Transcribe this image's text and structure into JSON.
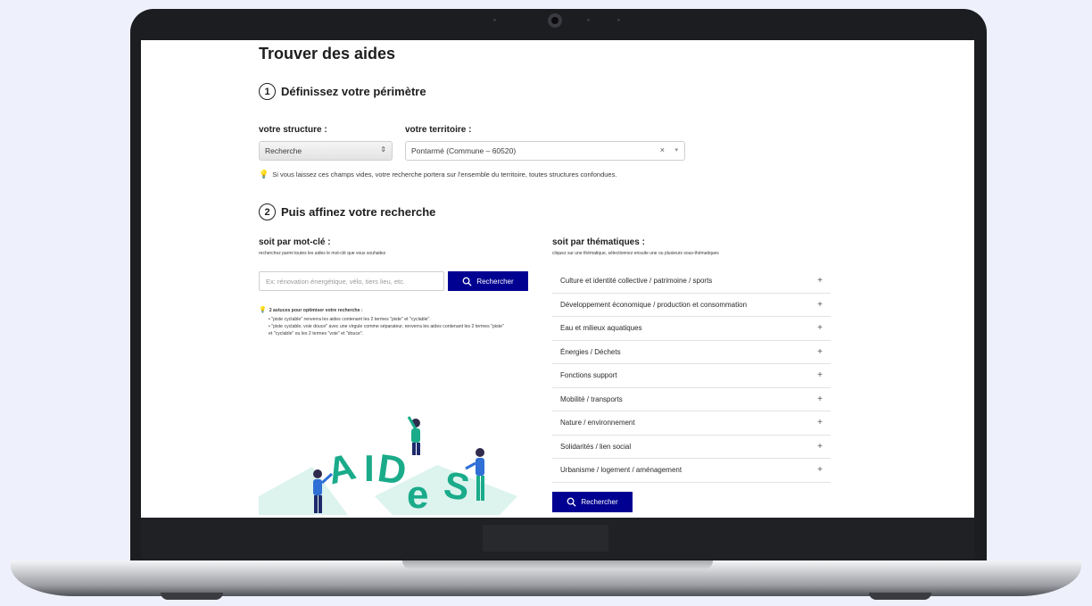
{
  "page": {
    "title": "Trouver des aides",
    "step1": {
      "num": "1",
      "label": "Définissez votre périmètre"
    },
    "step2": {
      "num": "2",
      "label": "Puis affinez votre recherche"
    }
  },
  "structure": {
    "label": "votre structure :",
    "value": "Recherche"
  },
  "territoire": {
    "label": "votre territoire :",
    "value": "Pontarmé (Commune – 60520)",
    "clear": "×",
    "arrow": "▾"
  },
  "hint": "Si vous laissez ces champs vides, votre recherche portera sur l'ensemble du territoire, toutes structures confondues.",
  "keyword": {
    "title": "soit par mot-clé :",
    "subtitle": "recherchez parmi toutes les aides le mot-clé que vous souhaitez",
    "placeholder": "Ex: rénovation énergétique, vélo, tiers lieu, etc.",
    "button": "Rechercher",
    "tips_title": "2 astuces pour optimiser votre recherche :",
    "tips": [
      "\"piste cyclable\" renverra les aides contenant les 2 termes \"piste\" et \"cyclable\".",
      "\"piste cyclable, voie douce\" avec une virgule comme séparateur, renverra les aides contenant les 2 termes \"piste\" et \"cyclable\" ou les 2 termes \"voie\" et \"douce\"."
    ]
  },
  "thematics": {
    "title": "soit par thématiques :",
    "subtitle": "cliquez sur une thématique, sélectionnez ensuite une ou plusieurs sous-thématiques",
    "items": [
      "Culture et identité collective / patrimoine / sports",
      "Développement économique / production et consommation",
      "Eau et milieux aquatiques",
      "Énergies / Déchets",
      "Fonctions support",
      "Mobilité / transports",
      "Nature / environnement",
      "Solidarités / lien social",
      "Urbanisme / logement / aménagement"
    ],
    "expand_symbol": "+",
    "button": "Rechercher"
  },
  "illustration": {
    "letters": [
      "A",
      "I",
      "D",
      "e",
      "S"
    ]
  },
  "colors": {
    "primary": "#000091",
    "teal": "#1aab8a",
    "figure_blue": "#1d2a6b"
  }
}
